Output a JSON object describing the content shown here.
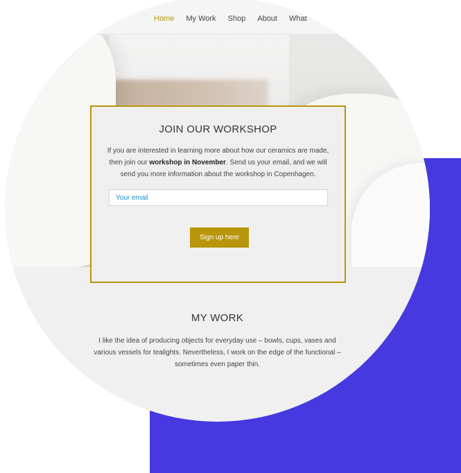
{
  "colors": {
    "accent": "#b8950a",
    "purple_block": "#4639e0",
    "link_blue": "#1d8fc7",
    "text": "#444444"
  },
  "nav": {
    "items": [
      {
        "label": "Home",
        "active": true
      },
      {
        "label": "My Work",
        "active": false
      },
      {
        "label": "Shop",
        "active": false
      },
      {
        "label": "About",
        "active": false
      },
      {
        "label": "What",
        "active": false
      }
    ]
  },
  "modal": {
    "close_icon": "close-icon",
    "title": "JOIN OUR WORKSHOP",
    "text_before": "If you are interested in learning more about how our ceramics are made, then join our ",
    "text_bold": "workshop in November",
    "text_after": ". Send us your email, and we will send you more information about the workshop in Copenhagen.",
    "email_placeholder": "Your email",
    "button_label": "Sign up here"
  },
  "my_work": {
    "title": "MY WORK",
    "text": "I like the idea of producing objects for everyday use – bowls, cups, vases and various vessels for tealights. Nevertheless, I work on the edge of the functional – sometimes even paper thin."
  }
}
